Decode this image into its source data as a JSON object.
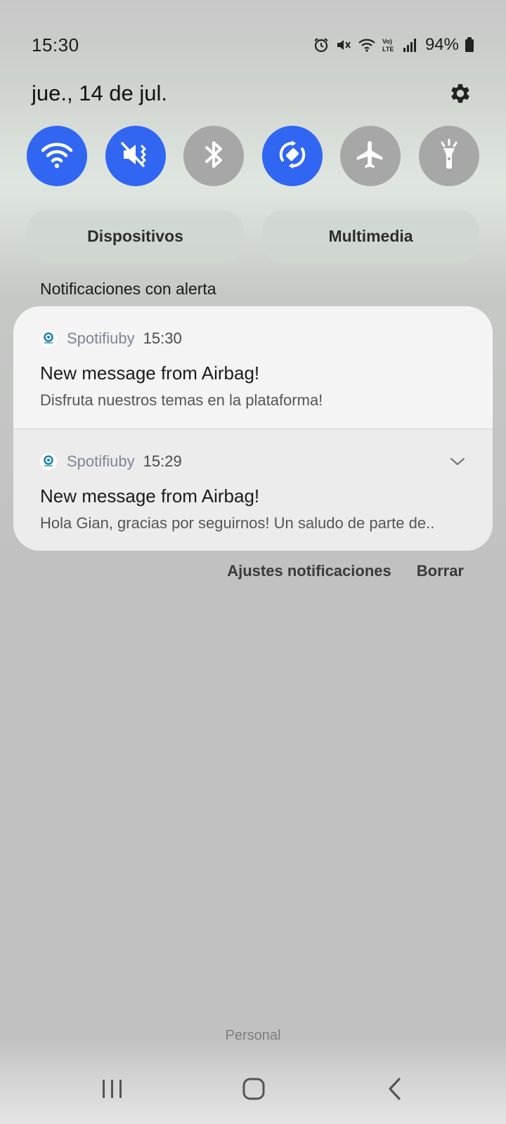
{
  "status_bar": {
    "time": "15:30",
    "battery": "94%",
    "icons": [
      "alarm-icon",
      "mute-icon",
      "wifi-icon",
      "volte-icon",
      "signal-icon",
      "battery-icon"
    ]
  },
  "header": {
    "date": "jue., 14 de jul.",
    "settings_icon": "gear-icon"
  },
  "quick_toggles": [
    {
      "name": "wifi",
      "icon": "wifi-icon",
      "state": "on"
    },
    {
      "name": "mute",
      "icon": "mute-icon",
      "state": "on"
    },
    {
      "name": "bluetooth",
      "icon": "bluetooth-icon",
      "state": "off"
    },
    {
      "name": "auto-rotate",
      "icon": "rotate-icon",
      "state": "on"
    },
    {
      "name": "airplane",
      "icon": "airplane-icon",
      "state": "off"
    },
    {
      "name": "flashlight",
      "icon": "flashlight-icon",
      "state": "off"
    }
  ],
  "buttons": {
    "devices": "Dispositivos",
    "media": "Multimedia"
  },
  "section_title": "Notificaciones con alerta",
  "notifications": [
    {
      "app": "Spotifiuby",
      "time": "15:30",
      "title": "New message from Airbag!",
      "body": "Disfruta nuestros temas en la plataforma!"
    },
    {
      "app": "Spotifiuby",
      "time": "15:29",
      "title": "New message from Airbag!",
      "body": "Hola Gian, gracias por seguirnos! Un saludo de parte de.."
    }
  ],
  "actions": {
    "settings": "Ajustes notificaciones",
    "clear": "Borrar"
  },
  "profile_label": "Personal",
  "colors": {
    "toggle_on": "#3066f2",
    "toggle_off": "#a7a7a7"
  }
}
